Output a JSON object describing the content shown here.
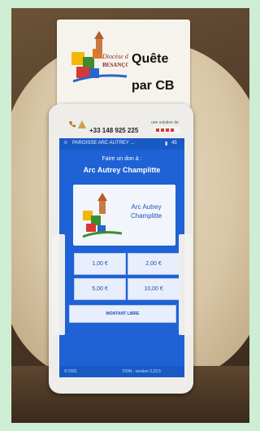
{
  "sign": {
    "line1": "Quête",
    "line2": "par CB"
  },
  "device_header": {
    "phone": "+33 148 925 225",
    "vendor_prefix": "une solution de"
  },
  "app": {
    "title": "PAROISSE ARC AUTREY ...",
    "status_right": "45",
    "prompt": "Faire un don à :",
    "recipient": "Arc Autrey Champlitte",
    "card_line1": "Arc Autrey",
    "card_line2": "Champlitte",
    "amounts": [
      "1,00 €",
      "2,00 €",
      "5,00 €",
      "10,00 €"
    ],
    "free_amount": "MONTANT LIBRE",
    "footer_left": "© DSS",
    "footer_right": "DON - version 3.23.5"
  },
  "colors": {
    "screen": "#1e62d6",
    "sign_bg": "#f6f3ec",
    "bag": "#d8c6a6"
  }
}
